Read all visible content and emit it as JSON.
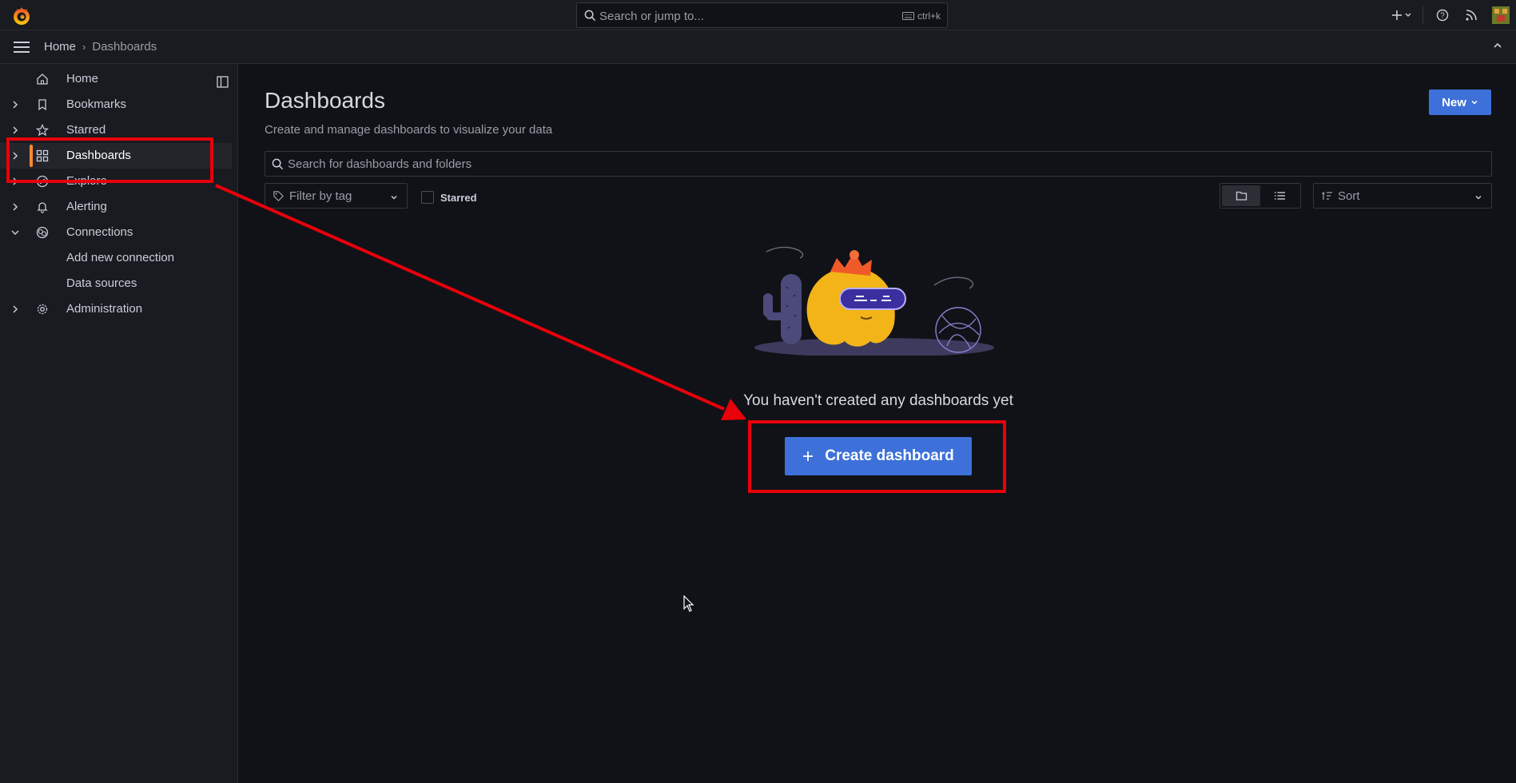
{
  "topbar": {
    "search_placeholder": "Search or jump to...",
    "shortcut": "ctrl+k",
    "icons": [
      "grafana-logo-icon",
      "plus-icon",
      "help-icon",
      "rss-icon",
      "user-avatar"
    ]
  },
  "breadcrumb": {
    "home": "Home",
    "separator": "›",
    "current": "Dashboards"
  },
  "sidebar": {
    "items": [
      {
        "label": "Home",
        "icon": "home-icon",
        "expandable": false
      },
      {
        "label": "Bookmarks",
        "icon": "bookmark-icon",
        "expandable": true
      },
      {
        "label": "Starred",
        "icon": "star-icon",
        "expandable": true
      },
      {
        "label": "Dashboards",
        "icon": "dashboards-grid-icon",
        "expandable": true,
        "active": true
      },
      {
        "label": "Explore",
        "icon": "compass-icon",
        "expandable": true
      },
      {
        "label": "Alerting",
        "icon": "bell-icon",
        "expandable": true
      },
      {
        "label": "Connections",
        "icon": "connections-icon",
        "expandable": true,
        "expanded": true
      },
      {
        "label": "Add new connection",
        "child": true
      },
      {
        "label": "Data sources",
        "child": true
      },
      {
        "label": "Administration",
        "icon": "gear-icon",
        "expandable": true
      }
    ]
  },
  "main": {
    "title": "Dashboards",
    "subtitle": "Create and manage dashboards to visualize your data",
    "new_button": "New",
    "search_placeholder": "Search for dashboards and folders",
    "tag_filter_placeholder": "Filter by tag",
    "starred_label": "Starred",
    "sort_placeholder": "Sort",
    "empty_message": "You haven't created any dashboards yet",
    "create_button": "Create dashboard"
  },
  "colors": {
    "accent_blue": "#3d71d9",
    "active_bar": "#ff8833",
    "annotation_red": "#e8000b",
    "background": "#111217",
    "panel": "#181b1f"
  }
}
